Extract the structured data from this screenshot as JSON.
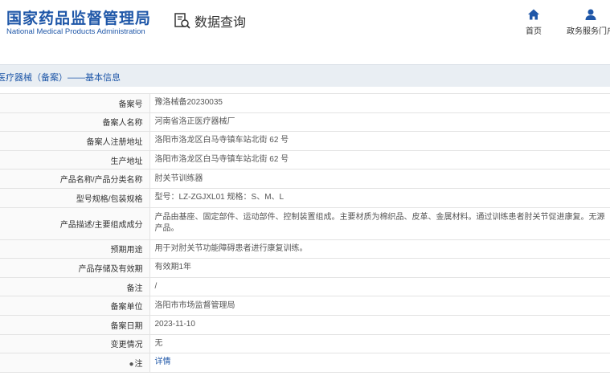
{
  "header": {
    "title_cn": "国家药品监督管理局",
    "title_en": "National Medical Products Administration",
    "query_label": "数据查询",
    "nav": [
      {
        "label": "首页",
        "icon": "home-icon"
      },
      {
        "label": "政务服务门户",
        "icon": "user-icon"
      }
    ]
  },
  "section": {
    "title": "医疗器械（备案）——基本信息"
  },
  "record": {
    "labels": {
      "filing_no": "备案号",
      "filer_name": "备案人名称",
      "filer_address": "备案人注册地址",
      "production_address": "生产地址",
      "product_name": "产品名称/产品分类名称",
      "model_spec": "型号规格/包装规格",
      "description": "产品描述/主要组成成分",
      "intended_use": "预期用途",
      "storage": "产品存储及有效期",
      "remarks": "备注",
      "filing_unit": "备案单位",
      "filing_date": "备案日期",
      "change": "变更情况",
      "note": "注"
    },
    "values": {
      "filing_no": "豫洛械备20230035",
      "filer_name": "河南省洛正医疗器械厂",
      "filer_address": "洛阳市洛龙区白马寺镇车站北街 62 号",
      "production_address": "洛阳市洛龙区白马寺镇车站北街 62 号",
      "product_name": "肘关节训练器",
      "model_spec": "型号：LZ-ZGJXL01 规格：S、M、L",
      "description": "产品由基座、固定部件、运动部件、控制装置组成。主要材质为棉织品、皮革、金属材料。通过训练患者肘关节促进康复。无源产品。",
      "intended_use": "用于对肘关节功能障碍患者进行康复训练。",
      "storage": "有效期1年",
      "remarks": "/",
      "filing_unit": "洛阳市市场监督管理局",
      "filing_date": "2023-11-10",
      "change": "无",
      "note": "详情"
    }
  },
  "colors": {
    "brand": "#1f57a8",
    "section_bg": "#e9eef3",
    "label_bg": "#fafafa"
  }
}
